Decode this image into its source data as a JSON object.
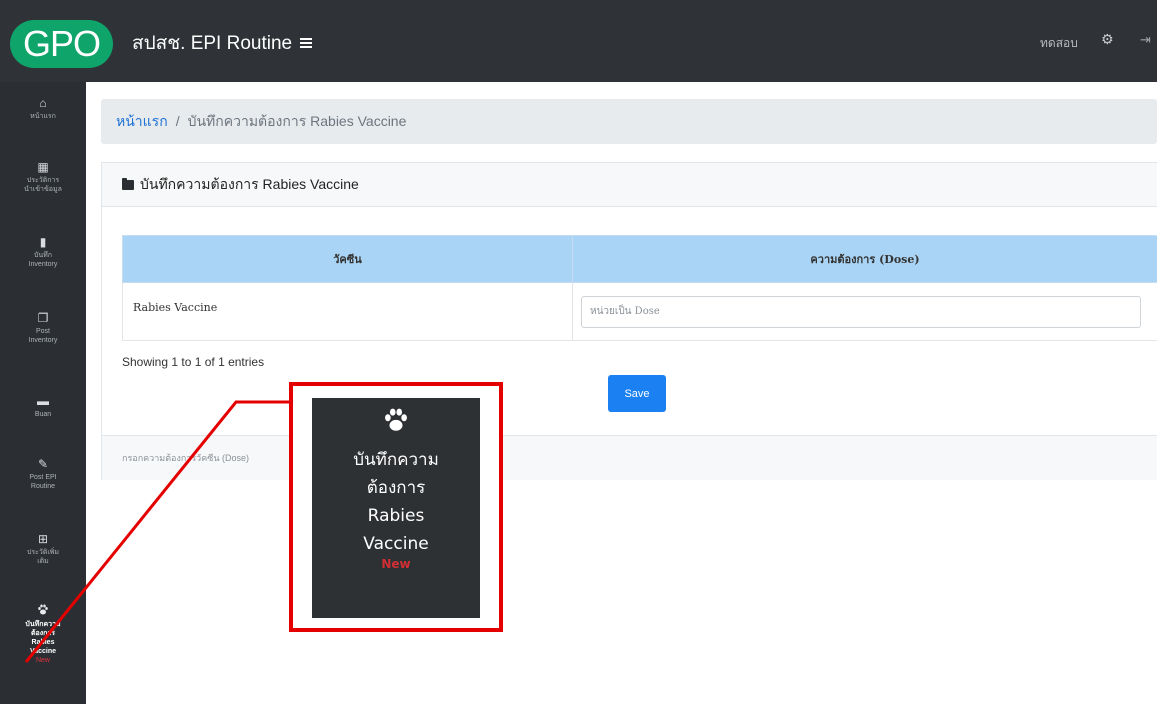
{
  "topbar": {
    "logo": "GPO",
    "app_title": "สปสช. EPI Routine",
    "user": "ทดสอบ",
    "gear_icon": "gear-icon",
    "logout_icon": "logout-icon"
  },
  "sidebar": {
    "items": [
      {
        "icon": "home-icon",
        "label": "หน้าแรก"
      },
      {
        "icon": "calendar-icon",
        "label": "ประวัติการ\nนำเข้าข้อมูล"
      },
      {
        "icon": "trash-icon",
        "label": "บันทึก\nInventory"
      },
      {
        "icon": "copy-icon",
        "label": "Post\nInventory"
      },
      {
        "icon": "truck-icon",
        "label": "Buan"
      },
      {
        "icon": "syringe-icon",
        "label": "Post EPI\nRoutine"
      },
      {
        "icon": "sitemap-icon",
        "label": "ประวัติเพิ่ม\nเติม"
      },
      {
        "icon": "paw-icon",
        "label": "บันทึกความ\nต้องการ\nRabies\nVaccine",
        "badge": "New",
        "active": true
      }
    ]
  },
  "breadcrumb": {
    "home": "หน้าแรก",
    "separator": "/",
    "current": "บันทึกความต้องการ Rabies Vaccine"
  },
  "card": {
    "title": "บันทึกความต้องการ Rabies Vaccine",
    "table": {
      "headers": [
        "วัคซีน",
        "ความต้องการ (Dose)"
      ],
      "rows": [
        {
          "vaccine": "Rabies Vaccine",
          "dose_value": "",
          "dose_placeholder": "หน่วยเป็น Dose"
        }
      ]
    },
    "entries_info": "Showing 1 to 1 of 1 entries",
    "save_label": "Save",
    "footer_note": "กรอกความต้องการวัคซีน (Dose)"
  },
  "callout": {
    "icon": "paw-icon",
    "lines": [
      "บันทึกความ",
      "ต้องการ",
      "Rabies",
      "Vaccine"
    ],
    "badge": "New",
    "border_color": "#e50000"
  },
  "colors": {
    "topbar_bg": "#2f3337",
    "logo_green": "#0fa46a",
    "table_header_blue": "#a9d4f5",
    "save_blue": "#1b80f2",
    "highlight_red": "#e50000"
  }
}
